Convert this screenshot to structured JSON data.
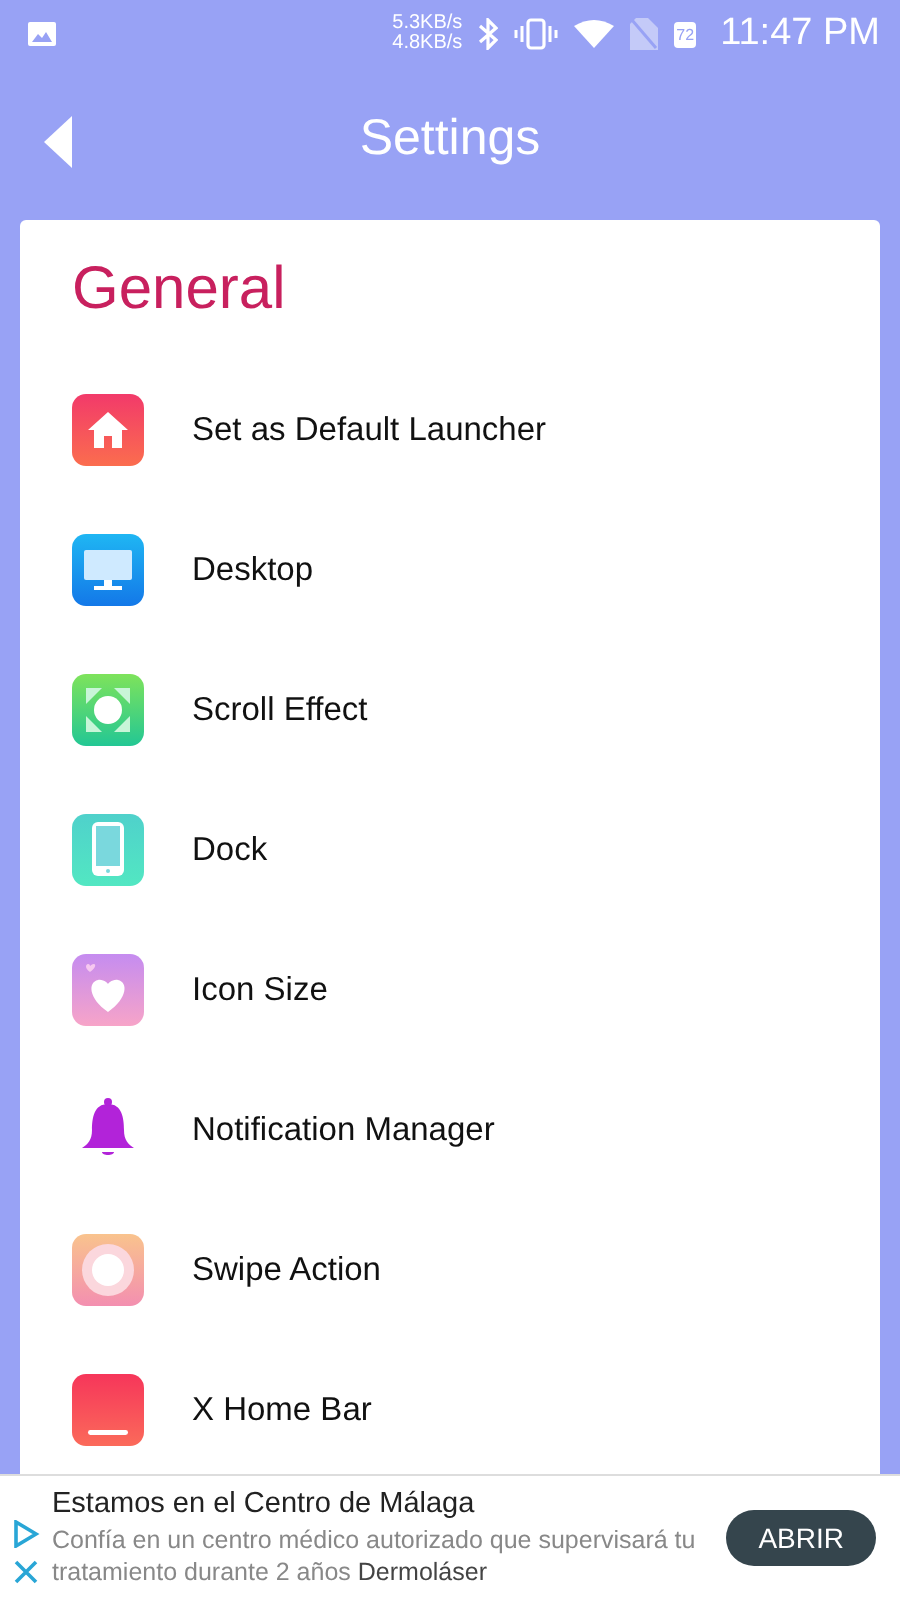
{
  "status_bar": {
    "upload_speed": "5.3KB/s",
    "download_speed": "4.8KB/s",
    "battery": "72",
    "time": "11:47 PM"
  },
  "header": {
    "title": "Settings"
  },
  "section": {
    "title": "General",
    "items": [
      {
        "label": "Set as Default Launcher",
        "kind": "home"
      },
      {
        "label": "Desktop",
        "kind": "desktop"
      },
      {
        "label": "Scroll Effect",
        "kind": "scroll"
      },
      {
        "label": "Dock",
        "kind": "dock"
      },
      {
        "label": "Icon Size",
        "kind": "heart"
      },
      {
        "label": "Notification Manager",
        "kind": "bell"
      },
      {
        "label": "Swipe Action",
        "kind": "swipe"
      },
      {
        "label": "X Home Bar",
        "kind": "homebar"
      }
    ]
  },
  "ad": {
    "title": "Estamos en el Centro de Málaga",
    "body": "Confía en un centro médico autorizado que supervisará tu tratamiento durante 2 años",
    "advertiser": "Dermoláser",
    "button": "ABRIR"
  }
}
